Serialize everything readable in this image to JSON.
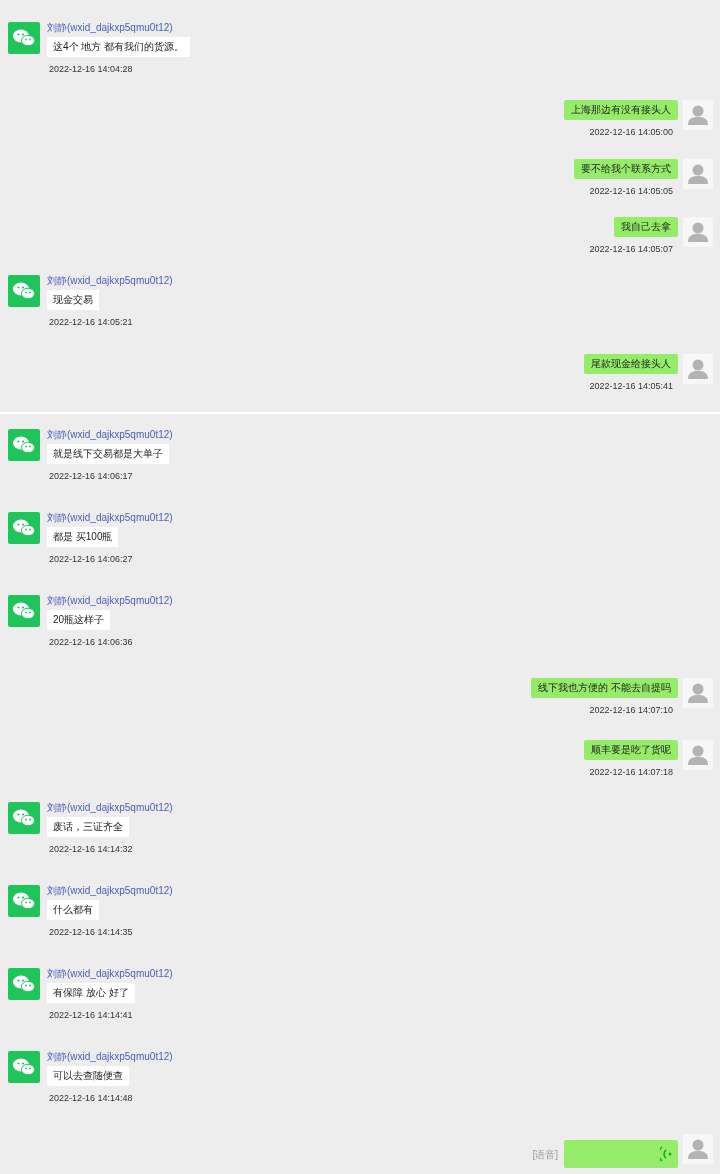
{
  "sections": [
    {
      "messages": [
        {
          "kind": "received",
          "sender": "刘静(wxid_dajkxp5qmu0t12)",
          "text": "这4个 地方 都有我们的货源。",
          "time": "2022-12-16 14:04:28"
        },
        {
          "kind": "sent",
          "text": "上海那边有没有接头人",
          "time": "2022-12-16 14:05:00"
        },
        {
          "kind": "sent",
          "text": "要不给我个联系方式",
          "time": "2022-12-16 14:05:05"
        },
        {
          "kind": "sent",
          "text": "我自己去拿",
          "time": "2022-12-16 14:05:07"
        },
        {
          "kind": "received",
          "sender": "刘静(wxid_dajkxp5qmu0t12)",
          "text": "现金交易",
          "time": "2022-12-16 14:05:21"
        },
        {
          "kind": "sent",
          "text": "尾款现金给接头人",
          "time": "2022-12-16 14:05:41"
        }
      ]
    },
    {
      "messages": [
        {
          "kind": "received",
          "sender": "刘静(wxid_dajkxp5qmu0t12)",
          "text": "就是线下交易都是大单子",
          "time": "2022-12-16 14:06:17"
        },
        {
          "kind": "received",
          "sender": "刘静(wxid_dajkxp5qmu0t12)",
          "text": "都是 买100瓶",
          "time": "2022-12-16 14:06:27"
        },
        {
          "kind": "received",
          "sender": "刘静(wxid_dajkxp5qmu0t12)",
          "text": "20瓶这样子",
          "time": "2022-12-16 14:06:36"
        },
        {
          "kind": "sent",
          "text": "线下我也方便的 不能去自提吗",
          "time": "2022-12-16 14:07:10"
        },
        {
          "kind": "sent",
          "text": "顺丰要是吃了货呢",
          "time": "2022-12-16 14:07:18"
        },
        {
          "kind": "received",
          "sender": "刘静(wxid_dajkxp5qmu0t12)",
          "text": "废话，三证齐全",
          "time": "2022-12-16 14:14:32"
        },
        {
          "kind": "received",
          "sender": "刘静(wxid_dajkxp5qmu0t12)",
          "text": "什么都有",
          "time": "2022-12-16 14:14:35"
        },
        {
          "kind": "received",
          "sender": "刘静(wxid_dajkxp5qmu0t12)",
          "text": "有保障 放心 好了",
          "time": "2022-12-16 14:14:41"
        },
        {
          "kind": "received",
          "sender": "刘静(wxid_dajkxp5qmu0t12)",
          "text": "可以去查随便查",
          "time": "2022-12-16 14:14:48"
        },
        {
          "kind": "voice",
          "label": "[语音]"
        }
      ]
    }
  ]
}
